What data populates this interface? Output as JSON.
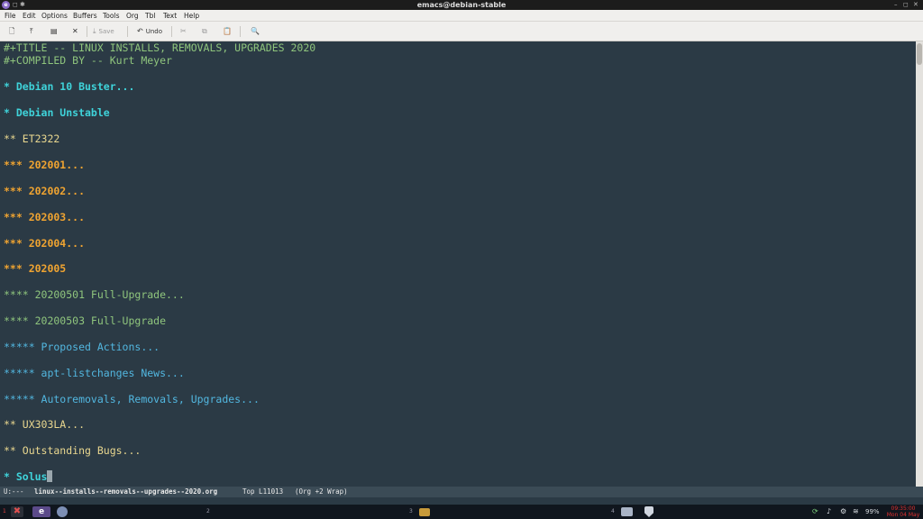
{
  "window": {
    "title": "emacs@debian-stable",
    "controls": {
      "minimize": "–",
      "maximize": "◻",
      "close": "✕"
    }
  },
  "menubar": [
    "File",
    "Edit",
    "Options",
    "Buffers",
    "Tools",
    "Org",
    "Tbl",
    "Text",
    "Help"
  ],
  "toolbar": {
    "save_label": "Save",
    "undo_label": "Undo",
    "icons": [
      "new-file-icon",
      "open-file-icon",
      "dired-icon",
      "close-buffer-icon",
      "save-icon",
      "undo-icon",
      "cut-icon",
      "copy-icon",
      "paste-icon",
      "search-icon"
    ]
  },
  "buffer": {
    "title_line": "#+TITLE -- LINUX INSTALLS, REMOVALS, UPGRADES 2020",
    "compiled_line": "#+COMPILED BY -- Kurt Meyer",
    "headings": [
      "* Debian 10 Buster...",
      "* Debian Unstable",
      "** ET2322",
      "*** 202001...",
      "*** 202002...",
      "*** 202003...",
      "*** 202004...",
      "*** 202005",
      "**** 20200501 Full-Upgrade...",
      "**** 20200503 Full-Upgrade",
      "***** Proposed Actions...",
      "***** apt-listchanges News...",
      "***** Autoremovals, Removals, Upgrades...",
      "** UX303LA...",
      "** Outstanding Bugs...",
      "* Solus"
    ]
  },
  "modeline": {
    "status": "U:---",
    "buffer_name": "linux--installs--removals--upgrades--2020.org",
    "position": "Top L11013",
    "modes": "(Org +2 Wrap)"
  },
  "taskbar": {
    "workspaces": [
      "1",
      "2",
      "3",
      "4"
    ],
    "battery": "99%",
    "clock_time": "09:35:00",
    "clock_date": "Mon 04 May"
  },
  "colors": {
    "editor_bg": "#2b3a45",
    "level1": "#3fd3da",
    "level2": "#e9d78f",
    "level3": "#f0a431",
    "level4": "#8fc57d",
    "level5": "#52b7e0"
  }
}
